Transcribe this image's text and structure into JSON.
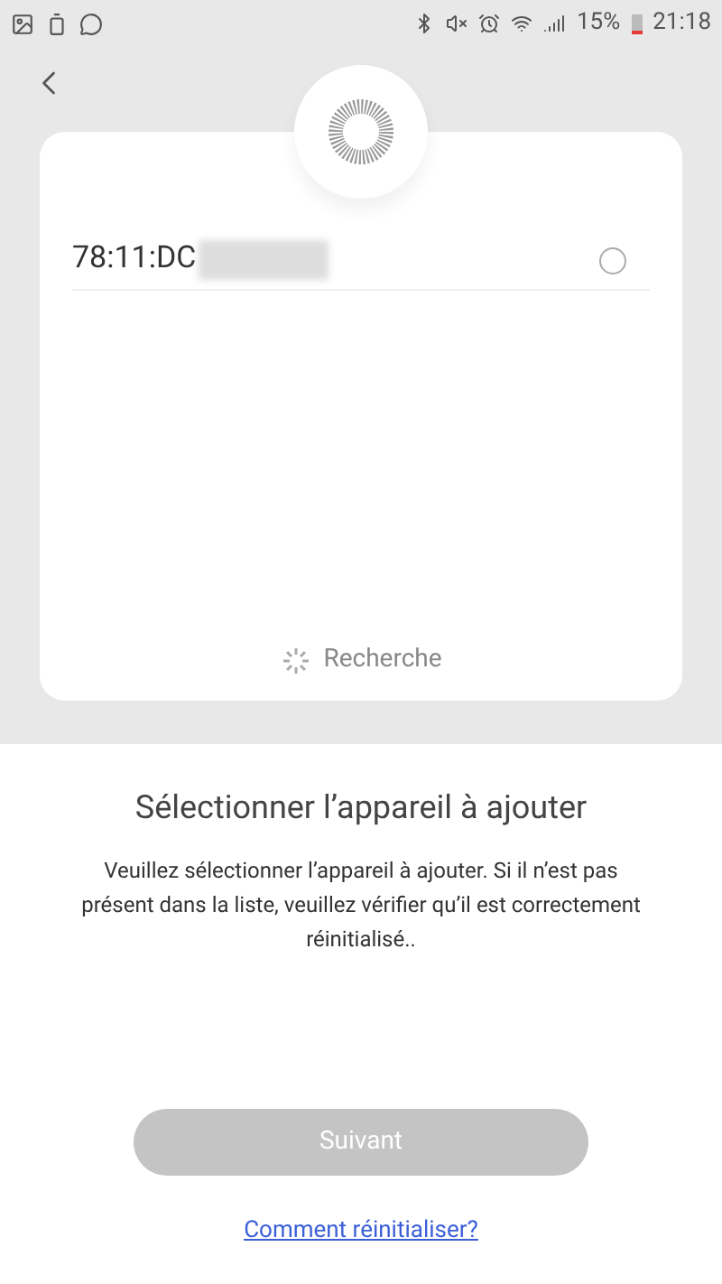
{
  "status_bar": {
    "battery": "15%",
    "time": "21:18"
  },
  "devices": [
    {
      "address": "78:11:DC",
      "selected": false
    }
  ],
  "searching": {
    "label": "Recherche"
  },
  "title": "Sélectionner l’appareil à ajouter",
  "description": "Veuillez sélectionner l’appareil à ajouter. Si il n’est pas présent dans la liste, veuillez vérifier qu’il est correctement réinitialisé..",
  "next_button": {
    "label": "Suivant",
    "disabled": true
  },
  "help_link": "Comment réinitialiser?"
}
